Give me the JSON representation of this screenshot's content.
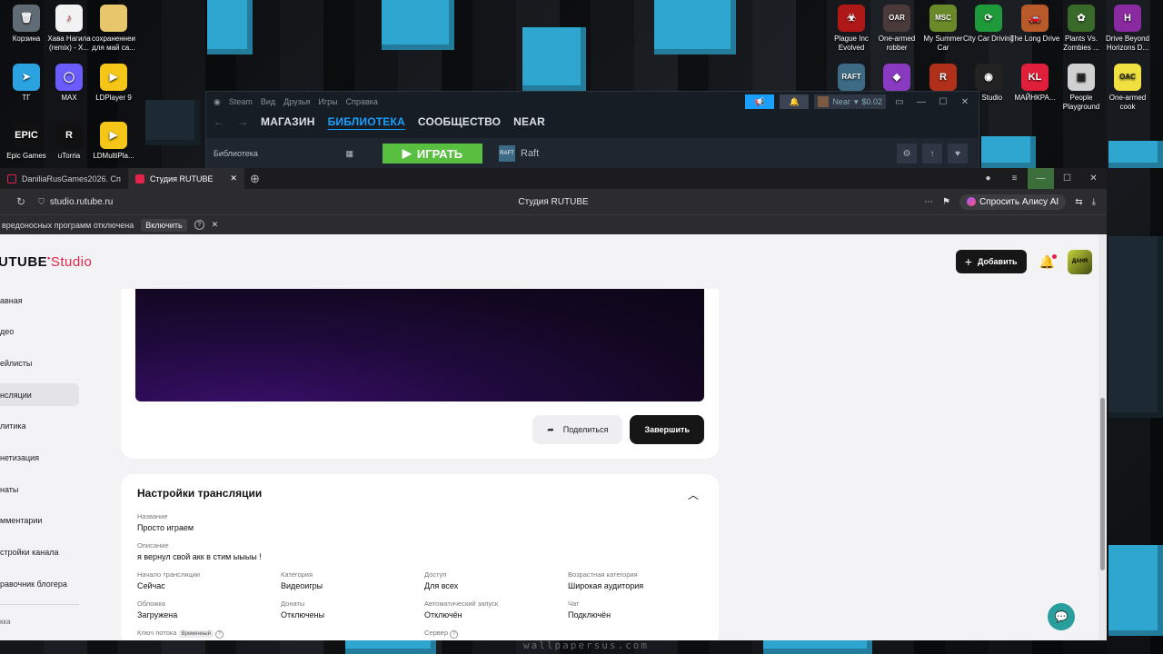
{
  "desktop": {
    "left_icons": [
      {
        "label": "Корзина",
        "icon": "recycle-bin-icon",
        "color": "#5f6b75",
        "glyph": "🗑"
      },
      {
        "label": "Хава Нагила (remix) - X...",
        "icon": "audio-file-icon",
        "color": "#f2f2f2",
        "glyph": "♪"
      },
      {
        "label": "сохраненнеи для май са...",
        "icon": "folder-icon",
        "color": "#e8c66b",
        "glyph": ""
      },
      {
        "label": "ТГ",
        "icon": "telegram-icon",
        "color": "#2aa3e0",
        "glyph": "➤"
      },
      {
        "label": "MAX",
        "icon": "max-icon",
        "color": "#6a5cff",
        "glyph": "◯"
      },
      {
        "label": "LDPlayer 9",
        "icon": "ldplayer-icon",
        "color": "#f5c518",
        "glyph": "▶"
      },
      {
        "label": "Epic Games",
        "icon": "epic-games-icon",
        "color": "#111111",
        "glyph": "EPIC"
      },
      {
        "label": "uTorria",
        "icon": "utorria-icon",
        "color": "#111111",
        "glyph": "R"
      },
      {
        "label": "LDMultiPla...",
        "icon": "ldmultiplayer-icon",
        "color": "#f5c518",
        "glyph": "▶"
      }
    ],
    "right_icons": [
      {
        "label": "Plague Inc Evolved",
        "icon": "plague-inc-icon",
        "color": "#b01818",
        "glyph": "☣"
      },
      {
        "label": "One-armed robber",
        "icon": "one-armed-robber-icon",
        "color": "#4a3a3a",
        "glyph": "OAR"
      },
      {
        "label": "My Summer Car",
        "icon": "my-summer-car-icon",
        "color": "#6a8a2a",
        "glyph": "MSC"
      },
      {
        "label": "City Car Driving",
        "icon": "city-car-driving-icon",
        "color": "#1f9a3a",
        "glyph": "⟳"
      },
      {
        "label": "The Long Drive",
        "icon": "the-long-drive-icon",
        "color": "#b85a2a",
        "glyph": "🚗"
      },
      {
        "label": "Plants Vs. Zombies ...",
        "icon": "pvz-icon",
        "color": "#3a6a2a",
        "glyph": "✿"
      },
      {
        "label": "Drive Beyond Horizons D...",
        "icon": "drive-beyond-icon",
        "color": "#8a2aa0",
        "glyph": "H"
      },
      {
        "label": "",
        "icon": "raft-desktop-icon",
        "color": "#3d6b85",
        "glyph": "RAFT"
      },
      {
        "label": "",
        "icon": "roblox-icon",
        "color": "#8a3ac0",
        "glyph": "◆"
      },
      {
        "label": "",
        "icon": "rust-icon",
        "color": "#b0301a",
        "glyph": "R"
      },
      {
        "label": "S Studio",
        "icon": "obs-studio-icon",
        "color": "#222222",
        "glyph": "◉"
      },
      {
        "label": "МАЙНКРА...",
        "icon": "minecraft-launcher-icon",
        "color": "#e0203a",
        "glyph": "KL"
      },
      {
        "label": "People Playground",
        "icon": "people-playground-icon",
        "color": "#d0d0d0",
        "glyph": "▣"
      },
      {
        "label": "One-armed cook",
        "icon": "one-armed-cook-icon",
        "color": "#f0e040",
        "glyph": "OAC"
      }
    ],
    "watermark": "wallpapersus.com"
  },
  "steam": {
    "menu": [
      "Steam",
      "Вид",
      "Друзья",
      "Игры",
      "Справка"
    ],
    "nav_tabs": [
      "МАГАЗИН",
      "БИБЛИОТЕКА",
      "СООБЩЕСТВО",
      "NEAR"
    ],
    "active_tab_index": 1,
    "library_label": "Библиотека",
    "play_label": "ИГРАТЬ",
    "game_name": "Raft",
    "user_name": "Near",
    "balance": "$0.02"
  },
  "browser": {
    "tabs": [
      {
        "label": "DaniliaRusGames2026. Сп",
        "favicon_color": "#e5234a"
      },
      {
        "label": "Студия RUTUBE",
        "favicon_color": "#e5234a"
      }
    ],
    "url": "studio.rutube.ru",
    "page_title": "Студия RUTUBE",
    "alice_label": "Спросить Алису AI",
    "warning_text": "вредоносных программ отключена",
    "enable_label": "Включить"
  },
  "studio": {
    "logo_main": "UTUBE",
    "logo_studio": "Studio",
    "add_label": "Добавить",
    "avatar_text": "ДАНЯ",
    "sidebar": [
      {
        "label": "авная",
        "active": false
      },
      {
        "label": "део",
        "active": false
      },
      {
        "label": "ейлисты",
        "active": false
      },
      {
        "label": "нсляции",
        "active": true
      },
      {
        "label": "литика",
        "active": false
      },
      {
        "label": "нетизация",
        "active": false
      },
      {
        "label": "наты",
        "active": false
      },
      {
        "label": "мментарии",
        "active": false
      },
      {
        "label": "стройки канала",
        "active": false
      },
      {
        "label": "равочник блогера",
        "active": false
      }
    ],
    "sidebar_bottom": "кка",
    "share_label": "Поделиться",
    "finish_label": "Завершить",
    "settings": {
      "title": "Настройки трансляции",
      "name_label": "Название",
      "name_value": "Просто играем",
      "desc_label": "Описание",
      "desc_value": "я вернул свой акк в стим ыыыы !",
      "grid": [
        {
          "label": "Начало трансляции",
          "value": "Сейчас"
        },
        {
          "label": "Категория",
          "value": "Видеоигры"
        },
        {
          "label": "Доступ",
          "value": "Для всех"
        },
        {
          "label": "Возрастная категория",
          "value": "Широкая аудитория"
        },
        {
          "label": "Обложка",
          "value": "Загружена"
        },
        {
          "label": "Донаты",
          "value": "Отключены"
        },
        {
          "label": "Автоматический запуск",
          "value": "Отключён"
        },
        {
          "label": "Чат",
          "value": "Подключён"
        }
      ],
      "stream_key_label": "Ключ потока",
      "temp_tag": "Временный",
      "server_label": "Сервер"
    }
  }
}
